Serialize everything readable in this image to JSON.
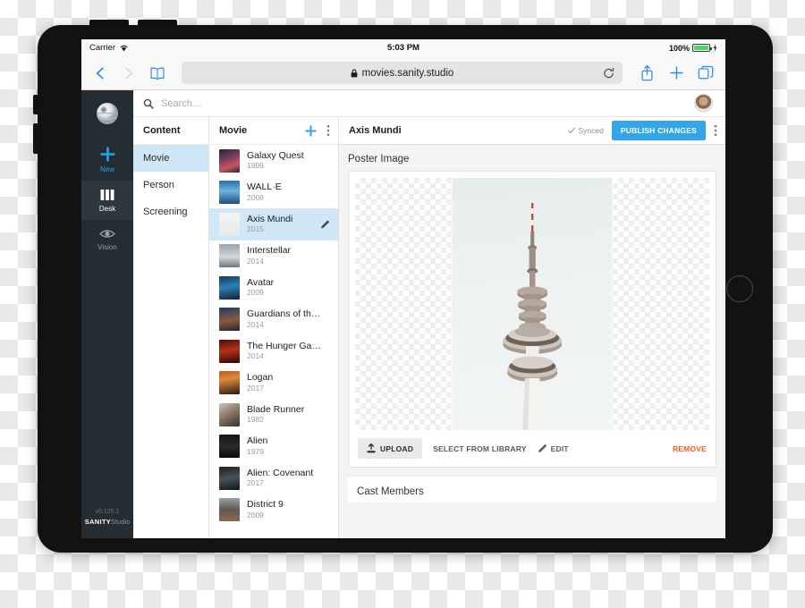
{
  "status_bar": {
    "carrier": "Carrier",
    "wifi_icon": "wifi-icon",
    "time": "5:03 PM",
    "battery_percent": "100%",
    "battery_icon": "battery-full-icon"
  },
  "browser": {
    "back_icon": "chevron-left-icon",
    "forward_icon": "chevron-right-icon",
    "bookmarks_icon": "book-icon",
    "lock_icon": "lock-icon",
    "url": "movies.sanity.studio",
    "reload_icon": "reload-icon",
    "share_icon": "share-icon",
    "new_tab_icon": "plus-icon",
    "tabs_icon": "tabs-icon"
  },
  "nav": {
    "logo_icon": "death-star-logo-icon",
    "items": [
      {
        "label": "New",
        "icon": "plus-icon"
      },
      {
        "label": "Desk",
        "icon": "columns-icon"
      },
      {
        "label": "Vision",
        "icon": "eye-icon"
      }
    ],
    "version": "v0.125.1",
    "brand_bold": "SANITY",
    "brand_light": "Studio"
  },
  "search": {
    "icon": "search-icon",
    "placeholder": "Search…",
    "avatar": "user-avatar"
  },
  "content_pane": {
    "title": "Content",
    "items": [
      {
        "label": "Movie",
        "selected": true
      },
      {
        "label": "Person",
        "selected": false
      },
      {
        "label": "Screening",
        "selected": false
      }
    ]
  },
  "movie_pane": {
    "title": "Movie",
    "add_icon": "plus-icon",
    "menu_icon": "kebab-menu-icon",
    "items": [
      {
        "title": "Galaxy Quest",
        "year": "1999",
        "selected": false,
        "poster": "linear-gradient(160deg,#2b1f38 0%,#7a3f5e 40%,#c9555c 70%,#2d2340 100%)"
      },
      {
        "title": "WALL·E",
        "year": "2008",
        "selected": false,
        "poster": "linear-gradient(180deg,#2c6fae 0%,#6fb3dd 45%,#1c4e80 100%)"
      },
      {
        "title": "Axis Mundi",
        "year": "2015",
        "selected": true,
        "poster": "linear-gradient(180deg,#f3f5f5 0%,#e7eaea 100%)"
      },
      {
        "title": "Interstellar",
        "year": "2014",
        "selected": false,
        "poster": "linear-gradient(180deg,#9aa4ac 0%,#d2d8dc 55%,#6d757c 100%)"
      },
      {
        "title": "Avatar",
        "year": "2009",
        "selected": false,
        "poster": "linear-gradient(170deg,#123a63 0%,#2f7fb4 45%,#0d2239 100%)"
      },
      {
        "title": "Guardians of the Galaxy",
        "year": "2014",
        "selected": false,
        "poster": "linear-gradient(170deg,#1d3c66 0%,#8a5a3c 55%,#2a2135 100%)"
      },
      {
        "title": "The Hunger Games: Mockin…",
        "year": "2014",
        "selected": false,
        "poster": "linear-gradient(170deg,#4a0c06 0%,#b4331a 45%,#2c0703 100%)"
      },
      {
        "title": "Logan",
        "year": "2017",
        "selected": false,
        "poster": "linear-gradient(170deg,#b8581f 0%,#e08a3c 35%,#2b1a12 100%)"
      },
      {
        "title": "Blade Runner",
        "year": "1982",
        "selected": false,
        "poster": "linear-gradient(150deg,#cfc6ba 0%,#8a7a68 45%,#3b3027 100%)"
      },
      {
        "title": "Alien",
        "year": "1979",
        "selected": false,
        "poster": "linear-gradient(180deg,#151515 0%,#2a2a2a 50%,#0b0b0b 100%)"
      },
      {
        "title": "Alien: Covenant",
        "year": "2017",
        "selected": false,
        "poster": "linear-gradient(170deg,#1d2226 0%,#47525a 50%,#11161a 100%)"
      },
      {
        "title": "District 9",
        "year": "2009",
        "selected": false,
        "poster": "linear-gradient(180deg,#97a1a6 0%,#5e5b52 50%,#8a6a4a 100%)"
      }
    ],
    "row_edit_icon": "pencil-icon"
  },
  "editor": {
    "doc_title": "Axis Mundi",
    "sync_icon": "check-icon",
    "sync_status": "Synced",
    "publish_label": "PUBLISH CHANGES",
    "menu_icon": "kebab-menu-icon",
    "poster_field_label": "Poster Image",
    "image_alt": "television-tower-photo",
    "toolbar": {
      "upload_icon": "upload-icon",
      "upload_label": "UPLOAD",
      "select_library_label": "SELECT FROM LIBRARY",
      "edit_icon": "pencil-icon",
      "edit_label": "EDIT",
      "remove_label": "REMOVE"
    },
    "cast_field_label": "Cast Members"
  },
  "device": {
    "home_button": "home-button"
  },
  "colors": {
    "accent_blue": "#32a6e8",
    "selection_blue": "#cfe7f6",
    "nav_dark": "#252c32",
    "remove_orange": "#f2572b",
    "battery_green": "#4cd964"
  }
}
